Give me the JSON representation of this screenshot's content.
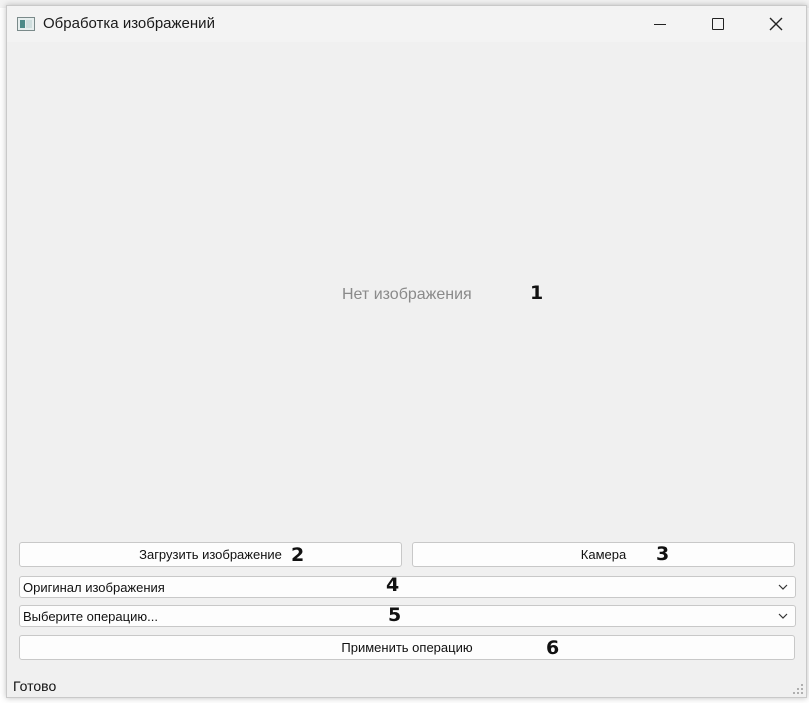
{
  "window": {
    "title": "Обработка изображений",
    "controls": {
      "minimize": "minimize",
      "maximize": "maximize",
      "close": "close"
    }
  },
  "image_area": {
    "placeholder": "Нет изображения",
    "annotation": "1"
  },
  "buttons": {
    "load_image": {
      "label": "Загрузить изображение",
      "annotation": "2"
    },
    "camera": {
      "label": "Камера",
      "annotation": "3"
    },
    "apply": {
      "label": "Применить операцию",
      "annotation": "6"
    }
  },
  "combos": {
    "view_mode": {
      "selected": "Оригинал изображения",
      "annotation": "4"
    },
    "operation": {
      "selected": "Выберите операцию...",
      "annotation": "5"
    }
  },
  "status_bar": {
    "text": "Готово"
  },
  "colors": {
    "window_bg": "#f0f0f0",
    "button_bg": "#fdfdfd",
    "border": "#c8c8c8",
    "placeholder_text": "#8a8a8a"
  }
}
